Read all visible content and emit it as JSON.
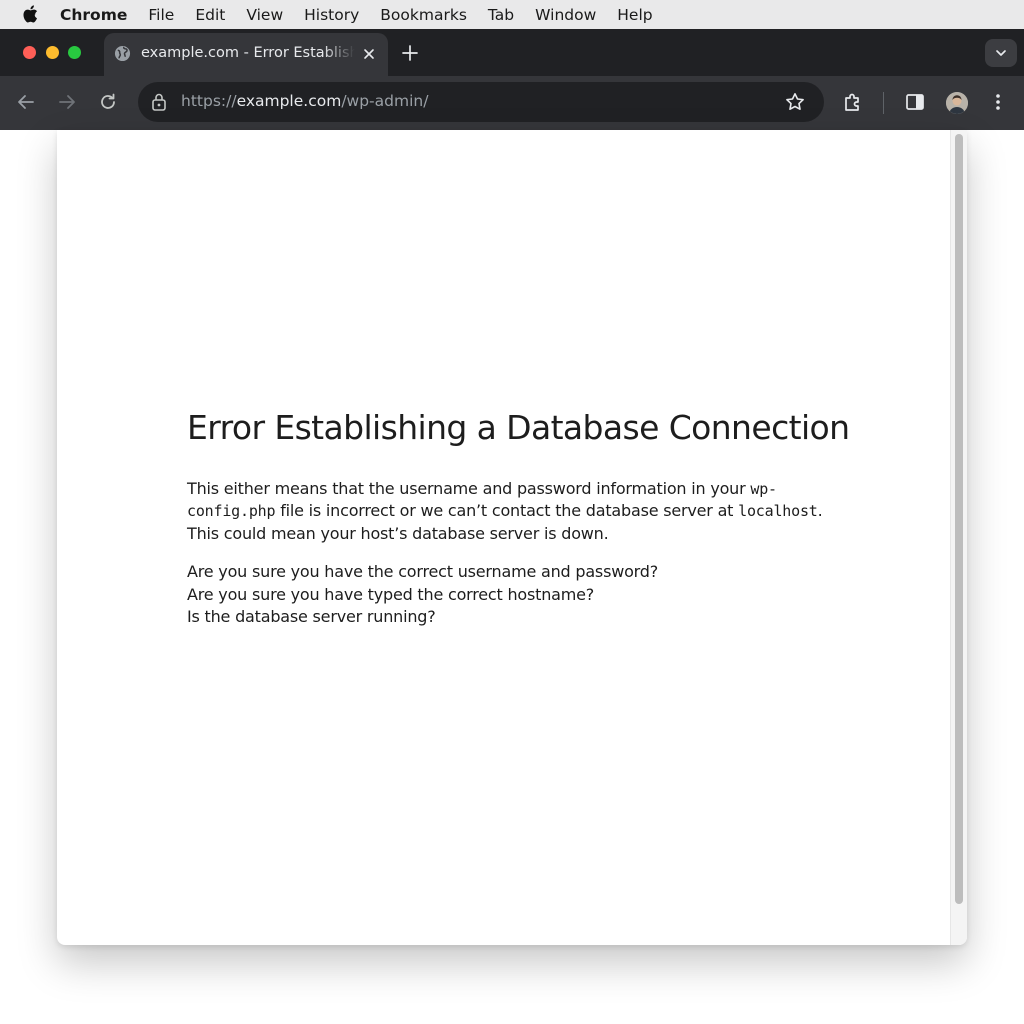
{
  "menubar": {
    "app": "Chrome",
    "items": [
      "File",
      "Edit",
      "View",
      "History",
      "Bookmarks",
      "Tab",
      "Window",
      "Help"
    ]
  },
  "tab": {
    "title": "example.com - Error Establishing a Database Connection"
  },
  "address": {
    "scheme": "https://",
    "host": "example.com",
    "path": "/wp-admin/"
  },
  "error": {
    "heading": "Error Establishing a Database Connection",
    "p1_a": "This either means that the username and password information in your ",
    "config_file": "wp-config.php",
    "p1_b": " file is incorrect or we can’t contact the database server at ",
    "host": "localhost",
    "p1_c": ". This could mean your host’s database server is down.",
    "questions": [
      "Are you sure you have the correct username and password?",
      "Are you sure you have typed the correct hostname?",
      "Is the database server running?"
    ]
  },
  "icons": [
    "apple-icon",
    "globe-icon",
    "close-icon",
    "plus-icon",
    "chevron-down-icon",
    "back-icon",
    "forward-icon",
    "reload-icon",
    "lock-icon",
    "star-icon",
    "extensions-icon",
    "side-panel-icon",
    "avatar",
    "more-icon"
  ]
}
